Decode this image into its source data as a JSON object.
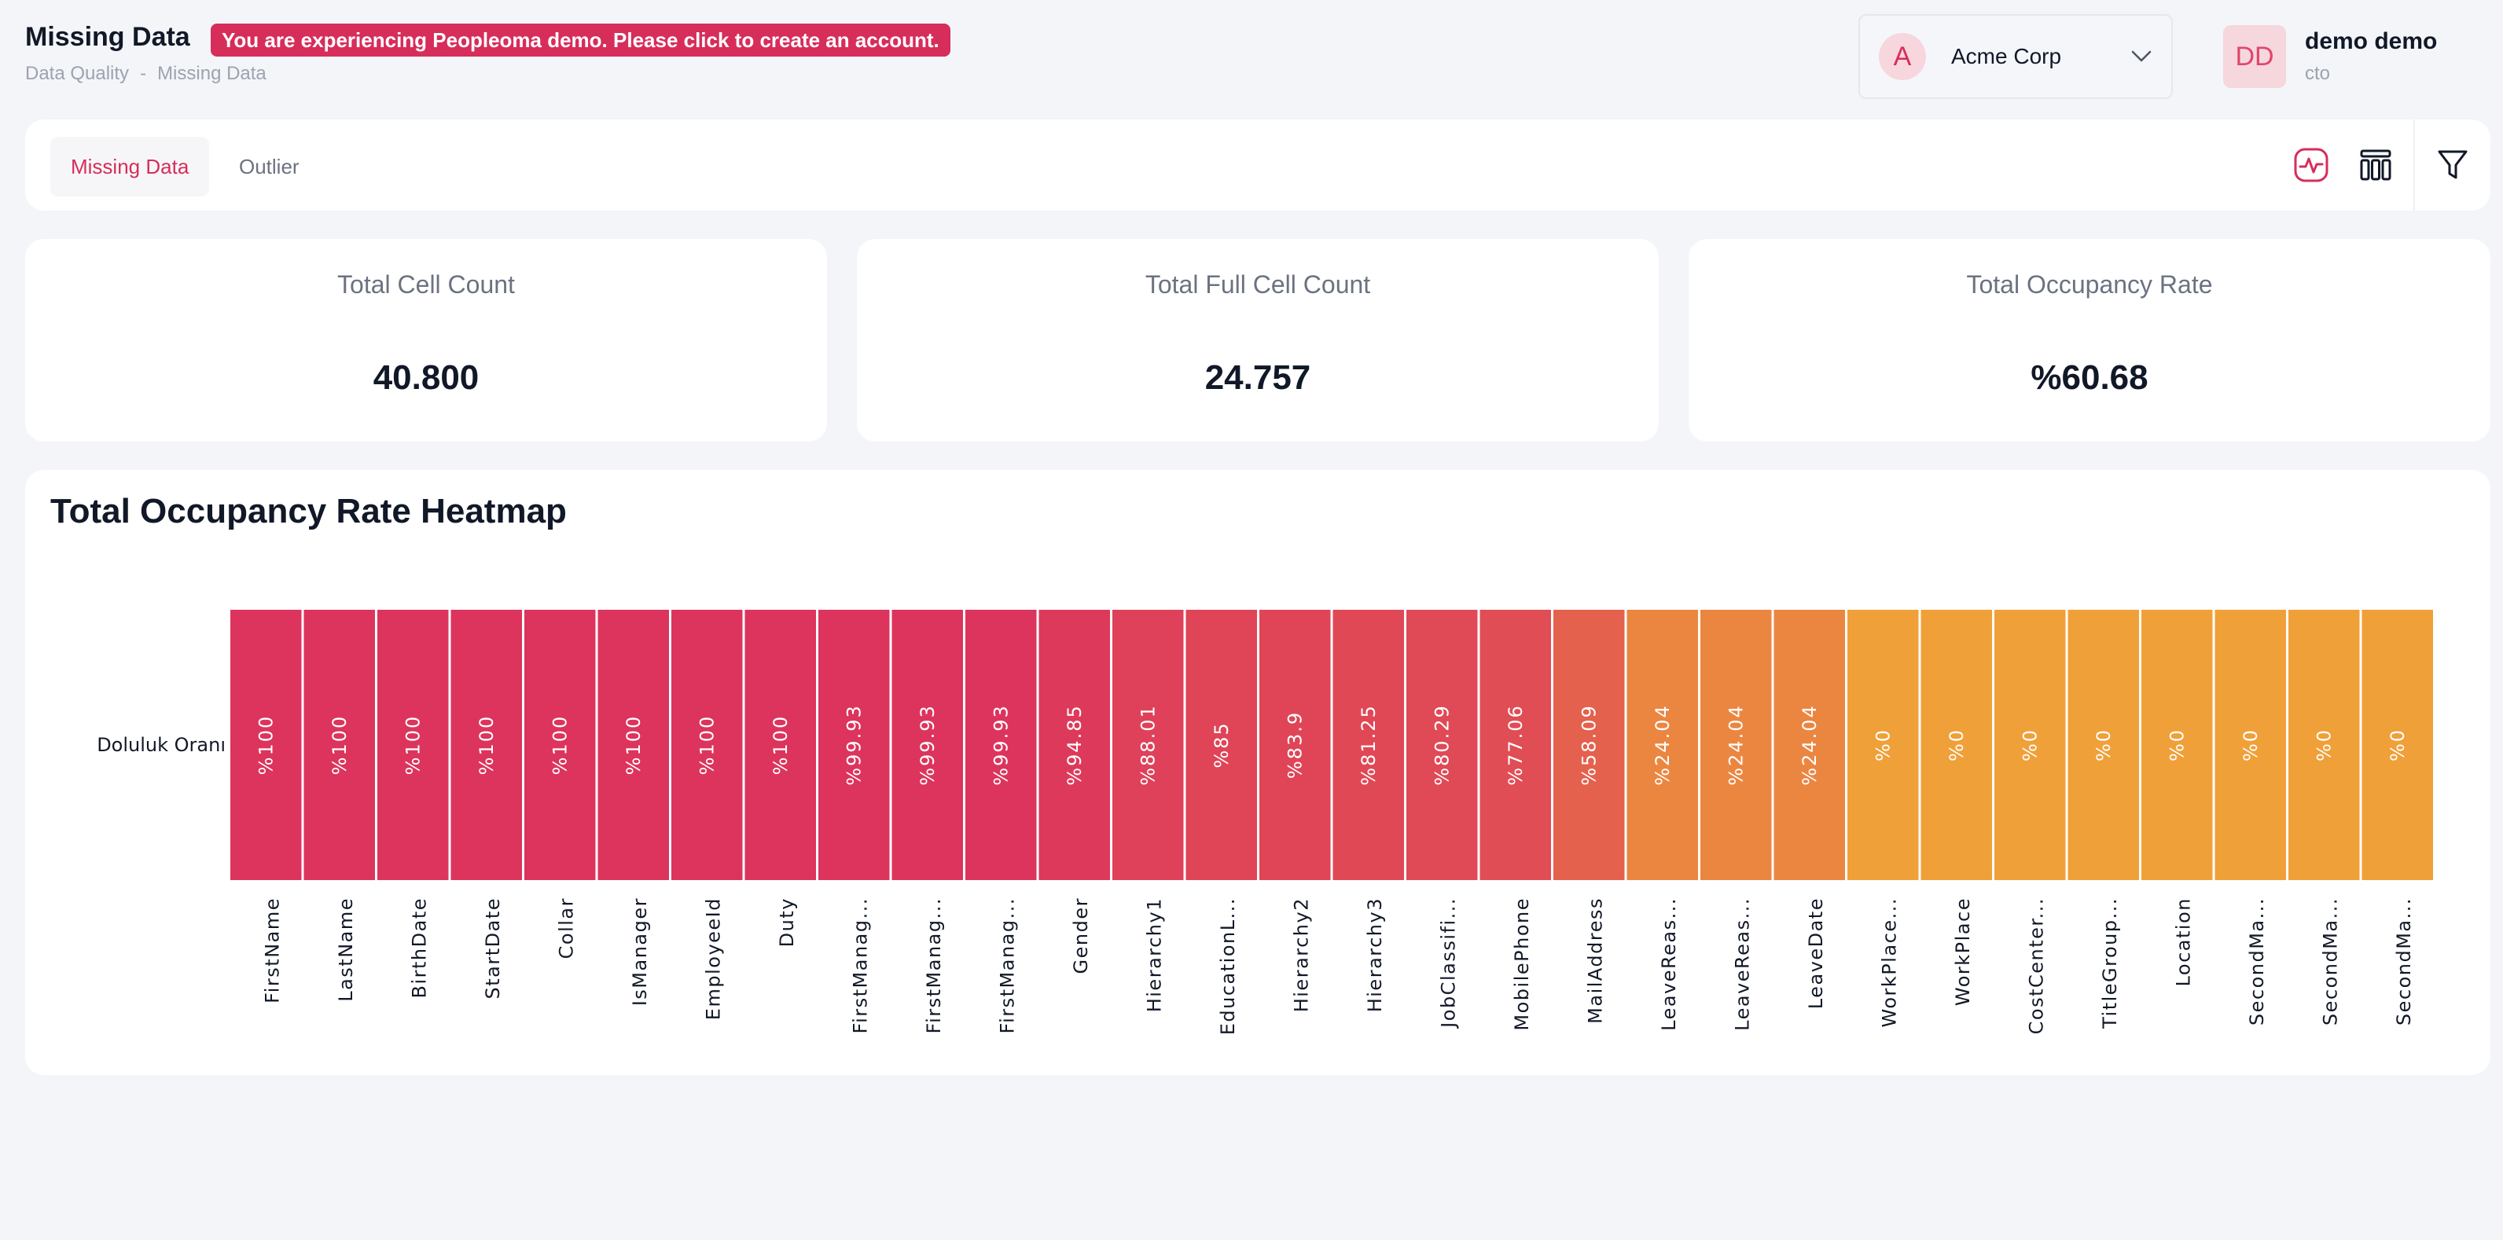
{
  "header": {
    "title": "Missing Data",
    "demo_banner": "You are experiencing Peopleoma demo. Please click to create an account.",
    "breadcrumb": [
      "Data Quality",
      "-",
      "Missing Data"
    ]
  },
  "company": {
    "avatar_letter": "A",
    "name": "Acme Corp"
  },
  "user": {
    "initials": "DD",
    "name": "demo demo",
    "role": "cto"
  },
  "tabs": [
    {
      "label": "Missing Data",
      "active": true
    },
    {
      "label": "Outlier",
      "active": false
    }
  ],
  "toolbar": {
    "icons": [
      "chart-icon",
      "columns-icon",
      "filter-icon"
    ]
  },
  "stats": [
    {
      "label": "Total Cell Count",
      "value": "40.800"
    },
    {
      "label": "Total Full Cell Count",
      "value": "24.757"
    },
    {
      "label": "Total Occupancy Rate",
      "value": "%60.68"
    }
  ],
  "colors": {
    "accent": "#d72d5a",
    "high": "#dc345d",
    "low": "#f0a038"
  },
  "chart_data": {
    "type": "heatmap",
    "title": "Total Occupancy Rate Heatmap",
    "row_label": "Doluluk Oranı",
    "columns": [
      "FirstName",
      "LastName",
      "BirthDate",
      "StartDate",
      "Collar",
      "IsManager",
      "EmployeeId",
      "Duty",
      "FirstManag...",
      "FirstManag...",
      "FirstManag...",
      "Gender",
      "Hierarchy1",
      "EducationL...",
      "Hierarchy2",
      "Hierarchy3",
      "JobClassifi...",
      "MobilePhone",
      "MailAddress",
      "LeaveReas...",
      "LeaveReas...",
      "LeaveDate",
      "WorkPlace...",
      "WorkPlace",
      "CostCenter...",
      "TitleGroup...",
      "Location",
      "SecondMa...",
      "SecondMa...",
      "SecondMa..."
    ],
    "values": [
      100,
      100,
      100,
      100,
      100,
      100,
      100,
      100,
      99.93,
      99.93,
      99.93,
      94.85,
      88.01,
      85,
      83.9,
      81.25,
      80.29,
      77.06,
      58.09,
      24.04,
      24.04,
      24.04,
      0,
      0,
      0,
      0,
      0,
      0,
      0,
      0
    ],
    "value_prefix": "%"
  }
}
